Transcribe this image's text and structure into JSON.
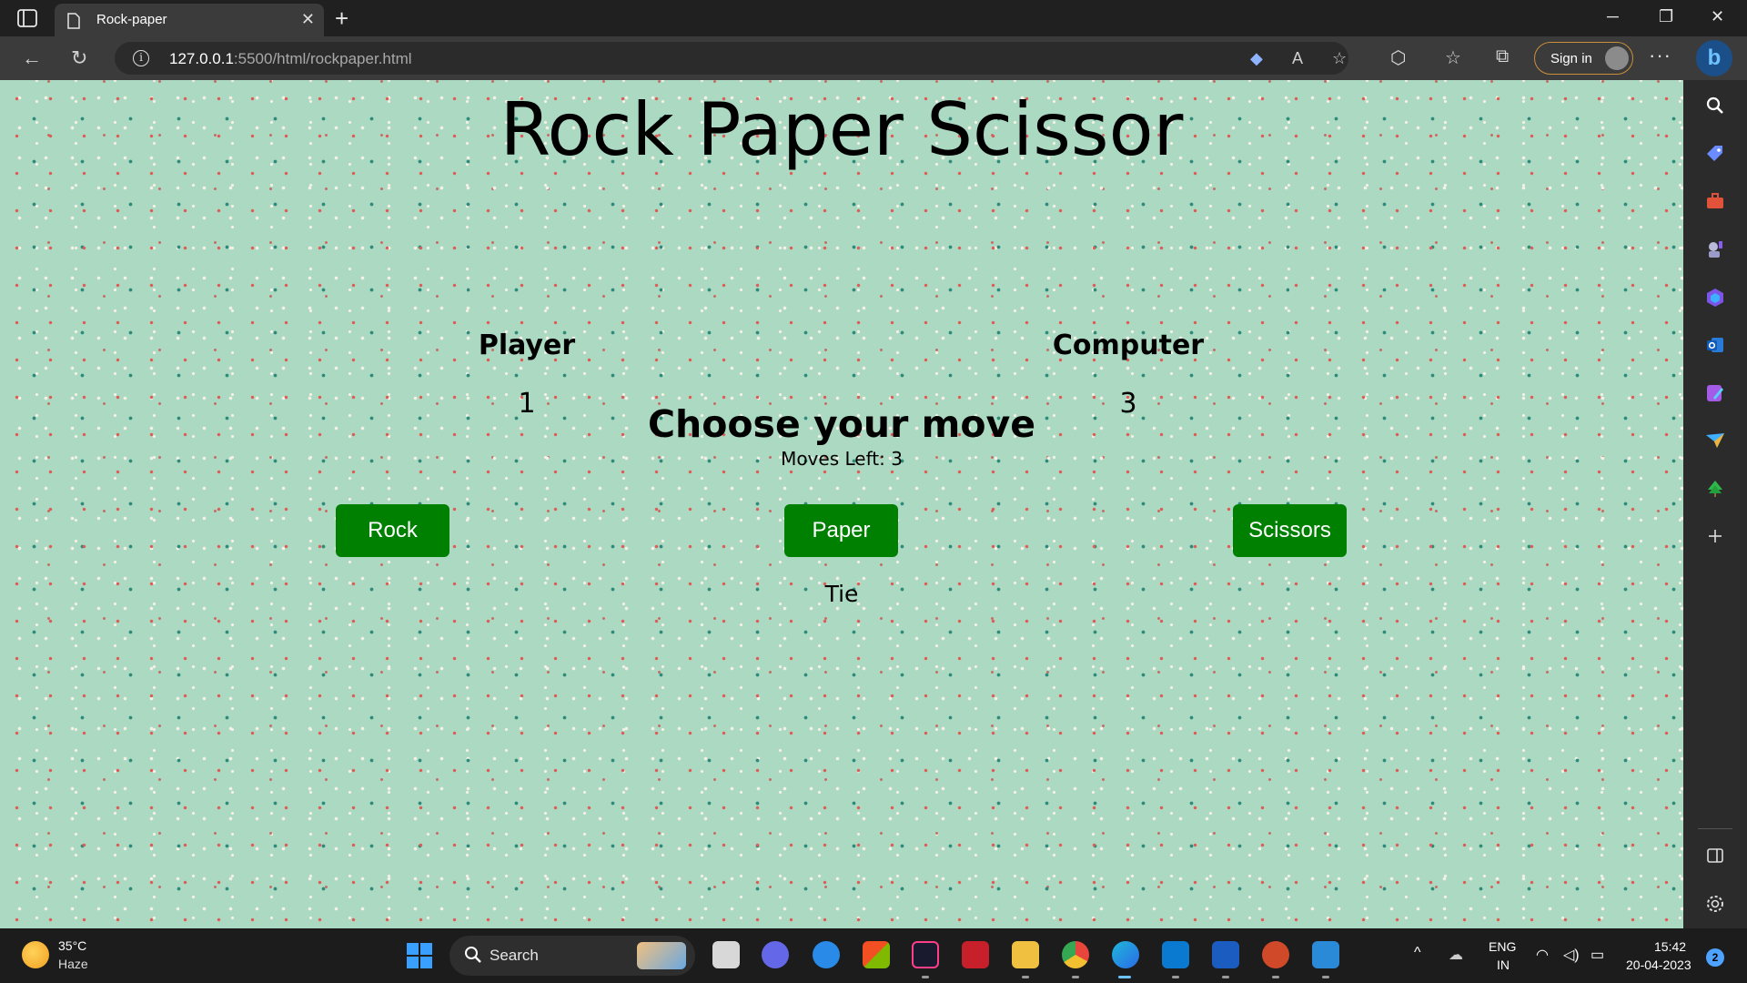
{
  "browser": {
    "tab_title": "Rock-paper",
    "url_host": "127.0.0.1",
    "url_rest": ":5500/html/rockpaper.html",
    "sign_in_label": "Sign in"
  },
  "game": {
    "title": "Rock Paper Scissor",
    "player_label": "Player",
    "player_score": "1",
    "computer_label": "Computer",
    "computer_score": "3",
    "prompt": "Choose your move",
    "moves_left": "Moves Left: 3",
    "buttons": {
      "rock": "Rock",
      "paper": "Paper",
      "scissors": "Scissors"
    },
    "result": "Tie",
    "accent_color": "#008000",
    "background_color": "#abd9c2"
  },
  "taskbar": {
    "weather_temp": "35°C",
    "weather_desc": "Haze",
    "search_label": "Search",
    "language": "ENG",
    "region": "IN",
    "time": "15:42",
    "date": "20-04-2023",
    "notification_count": "2"
  }
}
